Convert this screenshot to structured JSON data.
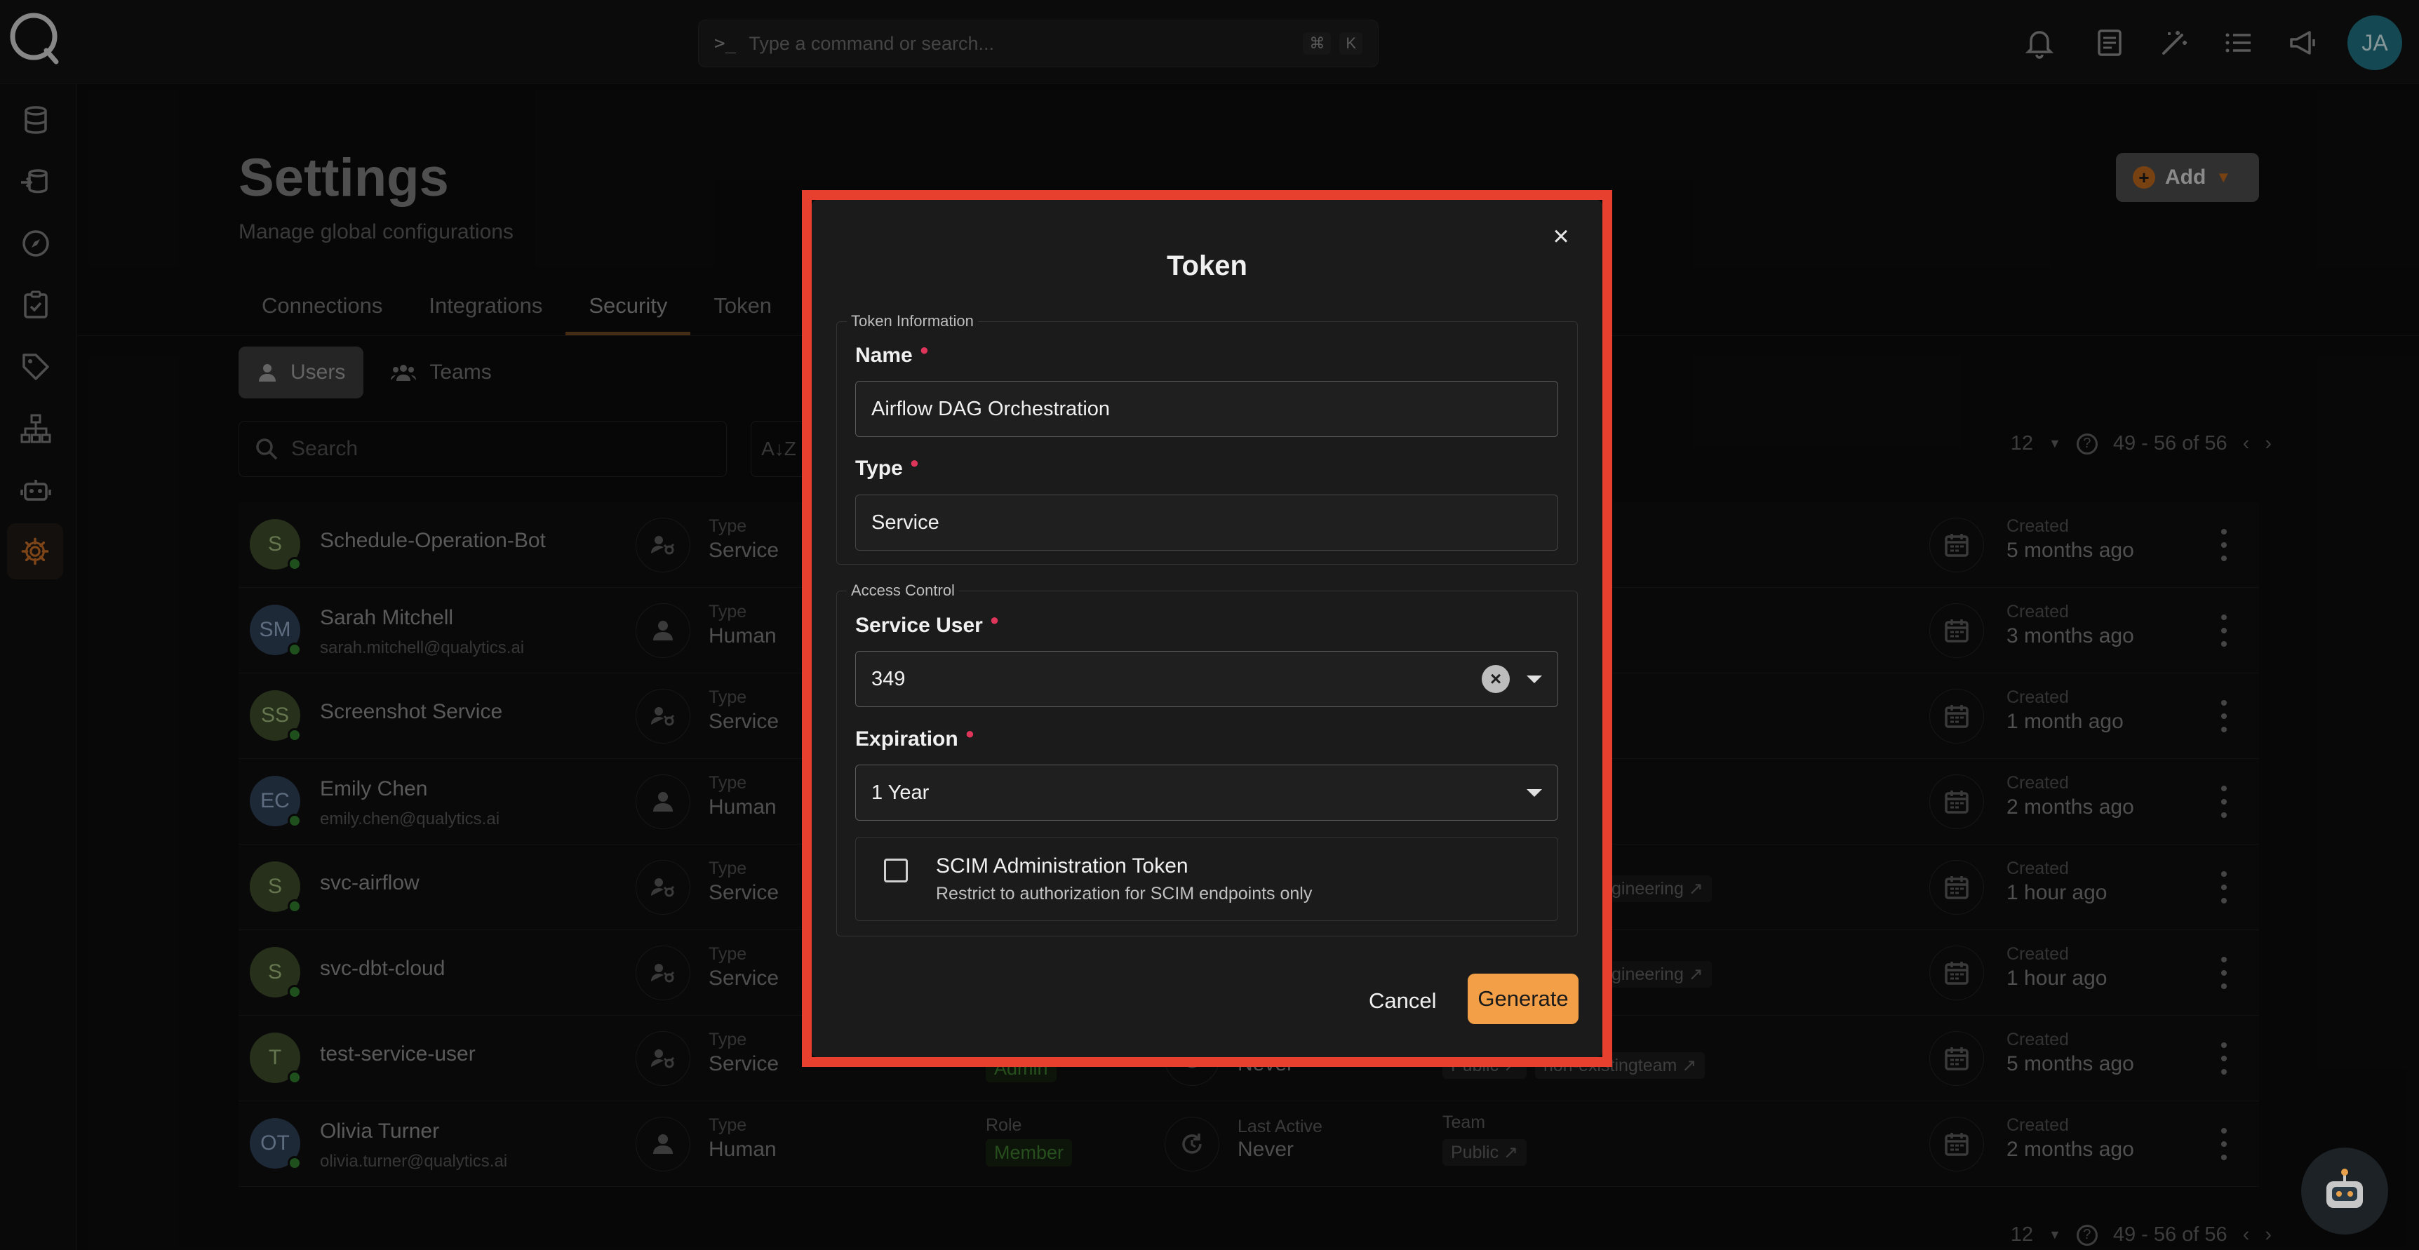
{
  "topbar": {
    "command_placeholder": "Type a command or search...",
    "shortcut_keys": [
      "⌘",
      "K"
    ],
    "user_initials": "JA"
  },
  "page": {
    "title": "Settings",
    "subtitle": "Manage global configurations",
    "add_label": "Add",
    "tabs": [
      "Connections",
      "Integrations",
      "Security",
      "Token"
    ],
    "active_tab": "Security",
    "segments": [
      "Users",
      "Teams"
    ],
    "active_segment": "Users",
    "search_placeholder": "Search",
    "page_size": "12",
    "range": "49 - 56 of 56"
  },
  "users": [
    {
      "initials": "S",
      "name": "Schedule-Operation-Bot",
      "email": "",
      "type_label": "Type",
      "type": "Service",
      "created_label": "Created",
      "created": "5 months ago",
      "color": "g"
    },
    {
      "initials": "SM",
      "name": "Sarah Mitchell",
      "email": "sarah.mitchell@qualytics.ai",
      "type_label": "Type",
      "type": "Human",
      "created_label": "Created",
      "created": "3 months ago",
      "color": "b"
    },
    {
      "initials": "SS",
      "name": "Screenshot Service",
      "email": "",
      "type_label": "Type",
      "type": "Service",
      "created_label": "Created",
      "created": "1 month ago",
      "color": "g"
    },
    {
      "initials": "EC",
      "name": "Emily Chen",
      "email": "emily.chen@qualytics.ai",
      "type_label": "Type",
      "type": "Human",
      "created_label": "Created",
      "created": "2 months ago",
      "color": "b"
    },
    {
      "initials": "S",
      "name": "svc-airflow",
      "email": "",
      "type_label": "Type",
      "type": "Service",
      "created_label": "Created",
      "created": "1 hour ago",
      "color": "g",
      "team_tag": "gineering ↗"
    },
    {
      "initials": "S",
      "name": "svc-dbt-cloud",
      "email": "",
      "type_label": "Type",
      "type": "Service",
      "created_label": "Created",
      "created": "1 hour ago",
      "color": "g",
      "team_tag": "gineering ↗"
    },
    {
      "initials": "T",
      "name": "test-service-user",
      "email": "",
      "type_label": "Type",
      "type": "Service",
      "created_label": "Created",
      "created": "5 months ago",
      "color": "g",
      "role": "Admin",
      "last_active": "Never",
      "team_pills": [
        "Public ↗",
        "non-existingteam ↗"
      ]
    },
    {
      "initials": "OT",
      "name": "Olivia Turner",
      "email": "olivia.turner@qualytics.ai",
      "type_label": "Type",
      "type": "Human",
      "created_label": "Created",
      "created": "2 months ago",
      "color": "b",
      "role_label": "Role",
      "role": "Member",
      "last_active_label": "Last Active",
      "last_active": "Never",
      "team_label": "Team",
      "team_pills": [
        "Public ↗"
      ]
    }
  ],
  "modal": {
    "title": "Token",
    "section_token_info": "Token Information",
    "name_label": "Name",
    "name_value": "Airflow DAG Orchestration",
    "type_label": "Type",
    "type_value": "Service",
    "section_access": "Access Control",
    "service_user_label": "Service User",
    "service_user_value": "349",
    "expiration_label": "Expiration",
    "expiration_value": "1 Year",
    "scim_title": "SCIM Administration Token",
    "scim_desc": "Restrict to authorization for SCIM endpoints only",
    "cancel_label": "Cancel",
    "generate_label": "Generate"
  },
  "colors": {
    "highlight": "#e8402f",
    "generate_button": "#f29f47",
    "required_marker": "#e0355b"
  }
}
